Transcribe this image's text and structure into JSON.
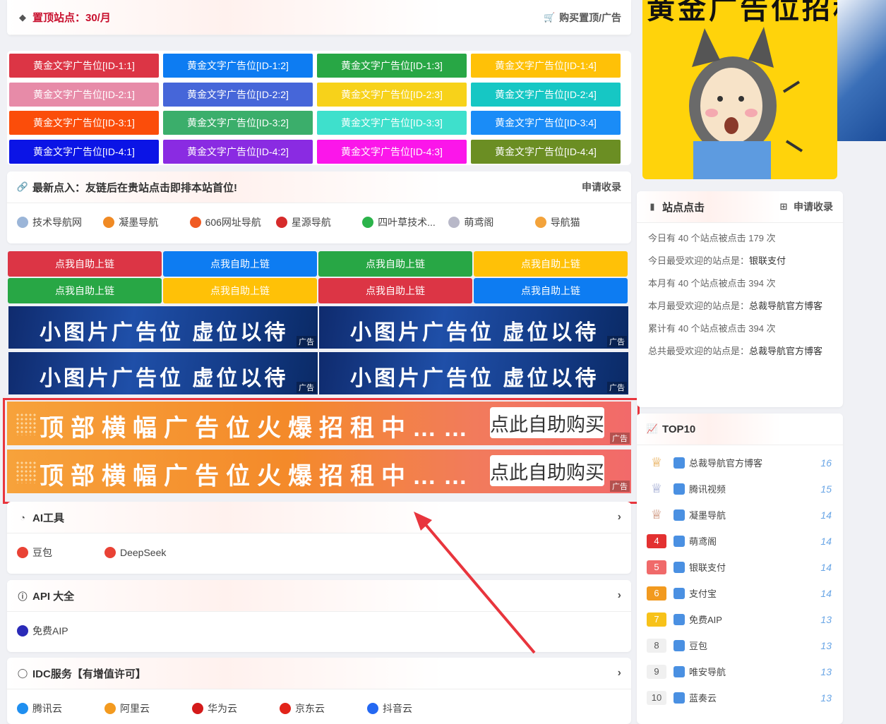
{
  "pinned": {
    "title": "置顶站点：30/月",
    "buy": "购买置顶/广告"
  },
  "gold_ads": [
    {
      "label": "黄金文字广告位[ID-1:1]",
      "color": "#dc3545"
    },
    {
      "label": "黄金文字广告位[ID-1:2]",
      "color": "#0d7cf2"
    },
    {
      "label": "黄金文字广告位[ID-1:3]",
      "color": "#28a745"
    },
    {
      "label": "黄金文字广告位[ID-1:4]",
      "color": "#ffc107"
    },
    {
      "label": "黄金文字广告位[ID-2:1]",
      "color": "#e78ba8"
    },
    {
      "label": "黄金文字广告位[ID-2:2]",
      "color": "#4666d9"
    },
    {
      "label": "黄金文字广告位[ID-2:3]",
      "color": "#f7d21a"
    },
    {
      "label": "黄金文字广告位[ID-2:4]",
      "color": "#16c7c4"
    },
    {
      "label": "黄金文字广告位[ID-3:1]",
      "color": "#fb4d0a"
    },
    {
      "label": "黄金文字广告位[ID-3:2]",
      "color": "#3bae6b"
    },
    {
      "label": "黄金文字广告位[ID-3:3]",
      "color": "#3ee0cc"
    },
    {
      "label": "黄金文字广告位[ID-3:4]",
      "color": "#1a8cf7"
    },
    {
      "label": "黄金文字广告位[ID-4:1]",
      "color": "#0b14e6"
    },
    {
      "label": "黄金文字广告位[ID-4:2]",
      "color": "#8a2be2"
    },
    {
      "label": "黄金文字广告位[ID-4:3]",
      "color": "#fb16ea"
    },
    {
      "label": "黄金文字广告位[ID-4:4]",
      "color": "#6b8e23"
    }
  ],
  "latest": {
    "title": "最新点入：友链后在贵站点击即排本站首位!",
    "apply": "申请收录",
    "links": [
      {
        "name": "技术导航网",
        "color": "#9bb5d8"
      },
      {
        "name": "凝墨导航",
        "color": "#f08a24"
      },
      {
        "name": "606网址导航",
        "color": "#f05a22"
      },
      {
        "name": "星源导航",
        "color": "#d62b2b"
      },
      {
        "name": "四叶草技术...",
        "color": "#2bb34a"
      },
      {
        "name": "萌鸢阁",
        "color": "#b8b8c8"
      },
      {
        "name": "导航猫",
        "color": "#f3a33b"
      }
    ]
  },
  "self_links": [
    {
      "label": "点我自助上链",
      "color": "#dc3545"
    },
    {
      "label": "点我自助上链",
      "color": "#0d7cf2"
    },
    {
      "label": "点我自助上链",
      "color": "#28a745"
    },
    {
      "label": "点我自助上链",
      "color": "#ffc107"
    },
    {
      "label": "点我自助上链",
      "color": "#28a745"
    },
    {
      "label": "点我自助上链",
      "color": "#ffc107"
    },
    {
      "label": "点我自助上链",
      "color": "#dc3545"
    },
    {
      "label": "点我自助上链",
      "color": "#0d7cf2"
    }
  ],
  "small_banners": {
    "text": "小图片广告位 虚位以待",
    "tag": "广告"
  },
  "wide_banners": {
    "text": "顶部横幅广告位火爆招租中……",
    "buy": "点此自助购买",
    "tag": "广告"
  },
  "sections": [
    {
      "title": "AI工具",
      "icon": "brain-icon",
      "items": [
        {
          "name": "豆包",
          "color": "#e94235"
        },
        {
          "name": "DeepSeek",
          "color": "#e94235"
        }
      ]
    },
    {
      "title": "API 大全",
      "icon": "info-icon",
      "items": [
        {
          "name": "免费AIP",
          "color": "#2a2ab8"
        }
      ]
    },
    {
      "title": "IDC服务【有增值许可】",
      "icon": "globe-icon",
      "items": [
        {
          "name": "腾讯云",
          "color": "#1f8ff0"
        },
        {
          "name": "阿里云",
          "color": "#f39a1f"
        },
        {
          "name": "华为云",
          "color": "#d41a1a"
        },
        {
          "name": "京东云",
          "color": "#e2231a"
        },
        {
          "name": "抖音云",
          "color": "#2468f2"
        }
      ]
    }
  ],
  "sidebar": {
    "ad_text": "黄金广告位招租中",
    "stats_title": "站点点击",
    "stats_apply": "申请收录",
    "stats": [
      {
        "label": "今日有 40 个站点被点击 179 次",
        "strong": ""
      },
      {
        "label": "今日最受欢迎的站点是：",
        "strong": "银联支付"
      },
      {
        "label": "本月有 40 个站点被点击 394 次",
        "strong": ""
      },
      {
        "label": "本月最受欢迎的站点是：",
        "strong": "总裁导航官方博客"
      },
      {
        "label": "累计有 40 个站点被点击 394 次",
        "strong": ""
      },
      {
        "label": "总共最受欢迎的站点是：",
        "strong": "总裁导航官方博客"
      }
    ],
    "top_title": "TOP10",
    "top": [
      {
        "rank": "1",
        "name": "总裁导航官方博客",
        "count": "16",
        "color": "#e2992e"
      },
      {
        "rank": "2",
        "name": "腾讯视频",
        "count": "15",
        "color": "#8a96c8"
      },
      {
        "rank": "3",
        "name": "凝墨导航",
        "count": "14",
        "color": "#c0785a"
      },
      {
        "rank": "4",
        "name": "萌鸢阁",
        "count": "14",
        "color": "#e33131"
      },
      {
        "rank": "5",
        "name": "银联支付",
        "count": "14",
        "color": "#f06a6a"
      },
      {
        "rank": "6",
        "name": "支付宝",
        "count": "14",
        "color": "#f29a1f"
      },
      {
        "rank": "7",
        "name": "免费AIP",
        "count": "13",
        "color": "#f7c21a"
      },
      {
        "rank": "8",
        "name": "豆包",
        "count": "13",
        "color": "#f0f0f0"
      },
      {
        "rank": "9",
        "name": "唯安导航",
        "count": "13",
        "color": "#f0f0f0"
      },
      {
        "rank": "10",
        "name": "蓝奏云",
        "count": "13",
        "color": "#f0f0f0"
      }
    ]
  }
}
